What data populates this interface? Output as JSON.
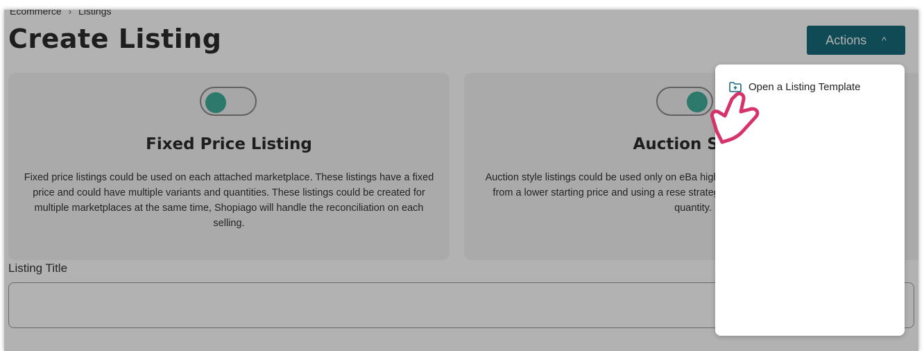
{
  "breadcrumb": {
    "root": "Ecommerce",
    "separator": "›",
    "current": "Listings"
  },
  "page": {
    "title": "Create Listing"
  },
  "actions": {
    "label": "Actions",
    "caret": "^"
  },
  "cards": {
    "fixed": {
      "title": "Fixed Price Listing",
      "description": "Fixed price listings could be used on each attached marketplace. These listings have a fixed price and could have multiple variants and quantities. These listings could be created for multiple marketplaces at the same time, Shopiago will handle the reconciliation on each selling.",
      "toggle_on": false
    },
    "auction": {
      "title": "Auction Style",
      "description": "Auction style listings could be used only on eBa higher price for your items than a pre-defined from a lower starting price and using a rese strategy. A fixed price listings can't have variar quantity.",
      "toggle_on": true
    }
  },
  "form": {
    "listing_title_label": "Listing Title",
    "listing_title_value": ""
  },
  "dropdown": {
    "items": [
      {
        "label": "Open a Listing Template",
        "icon": "folder-plus-icon"
      }
    ]
  },
  "colors": {
    "accent": "#176a7a",
    "toggle_knob": "#3fae9a",
    "cursor": "#d6336c"
  }
}
